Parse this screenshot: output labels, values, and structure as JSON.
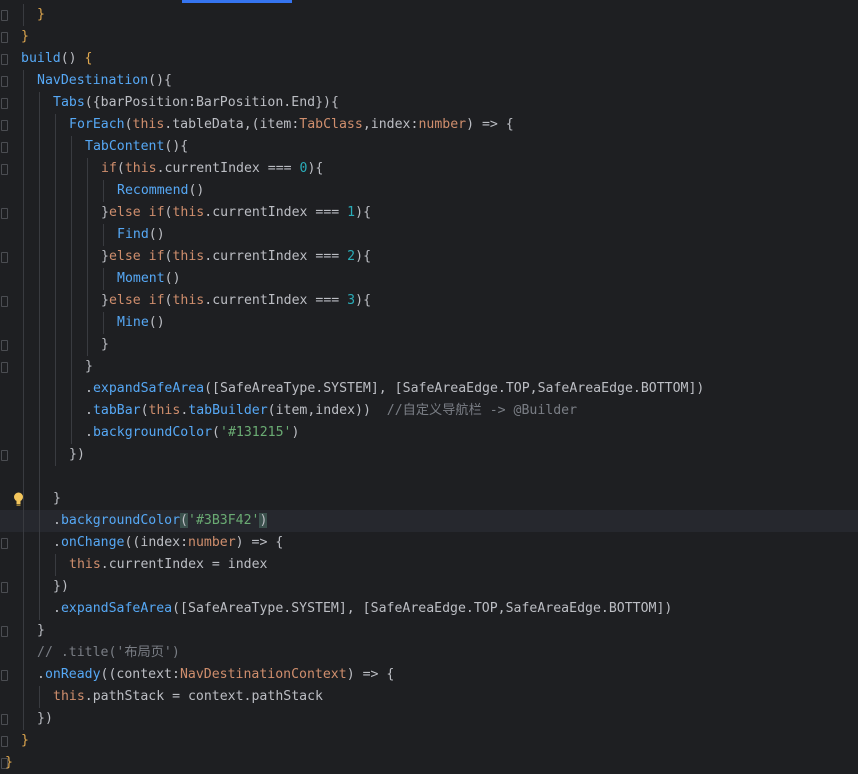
{
  "editor": {
    "accent_color": "#3574f0",
    "gutter_icons": {
      "intention_bulb": "lightbulb-icon",
      "fold_marker": "fold-marker-icon"
    },
    "lines": [
      {
        "indent": 1,
        "fold": true,
        "tokens": [
          {
            "t": "}",
            "c": "t-brace"
          }
        ]
      },
      {
        "indent": 0,
        "fold": true,
        "tokens": [
          {
            "t": "}",
            "c": "t-brace"
          }
        ]
      },
      {
        "indent": 0,
        "fold": true,
        "tokens": [
          {
            "t": "build",
            "c": "t-fn"
          },
          {
            "t": "() ",
            "c": "t-plain"
          },
          {
            "t": "{",
            "c": "t-brace"
          }
        ]
      },
      {
        "indent": 1,
        "fold": true,
        "tokens": [
          {
            "t": "NavDestination",
            "c": "t-comp"
          },
          {
            "t": "(){",
            "c": "t-plain"
          }
        ]
      },
      {
        "indent": 2,
        "fold": true,
        "tokens": [
          {
            "t": "Tabs",
            "c": "t-comp"
          },
          {
            "t": "({",
            "c": "t-plain"
          },
          {
            "t": "barPosition",
            "c": "t-plain"
          },
          {
            "t": ":",
            "c": "t-plain"
          },
          {
            "t": "BarPosition",
            "c": "t-plain"
          },
          {
            "t": ".",
            "c": "t-plain"
          },
          {
            "t": "End",
            "c": "t-plain"
          },
          {
            "t": "}){",
            "c": "t-plain"
          }
        ]
      },
      {
        "indent": 3,
        "fold": true,
        "tokens": [
          {
            "t": "ForEach",
            "c": "t-comp"
          },
          {
            "t": "(",
            "c": "t-plain"
          },
          {
            "t": "this",
            "c": "t-kw"
          },
          {
            "t": ".tableData,(",
            "c": "t-plain"
          },
          {
            "t": "item",
            "c": "t-plain"
          },
          {
            "t": ":",
            "c": "t-plain"
          },
          {
            "t": "TabClass",
            "c": "t-type"
          },
          {
            "t": ",",
            "c": "t-plain"
          },
          {
            "t": "index",
            "c": "t-plain"
          },
          {
            "t": ":",
            "c": "t-plain"
          },
          {
            "t": "number",
            "c": "t-type"
          },
          {
            "t": ") => {",
            "c": "t-plain"
          }
        ]
      },
      {
        "indent": 4,
        "fold": true,
        "tokens": [
          {
            "t": "TabContent",
            "c": "t-comp"
          },
          {
            "t": "(){",
            "c": "t-plain"
          }
        ]
      },
      {
        "indent": 5,
        "fold": true,
        "tokens": [
          {
            "t": "if",
            "c": "t-kw"
          },
          {
            "t": "(",
            "c": "t-plain"
          },
          {
            "t": "this",
            "c": "t-kw"
          },
          {
            "t": ".currentIndex === ",
            "c": "t-plain"
          },
          {
            "t": "0",
            "c": "t-num"
          },
          {
            "t": "){",
            "c": "t-plain"
          }
        ]
      },
      {
        "indent": 6,
        "fold": false,
        "tokens": [
          {
            "t": "Recommend",
            "c": "t-comp"
          },
          {
            "t": "()",
            "c": "t-plain"
          }
        ]
      },
      {
        "indent": 5,
        "fold": true,
        "tokens": [
          {
            "t": "}",
            "c": "t-plain"
          },
          {
            "t": "else if",
            "c": "t-kw"
          },
          {
            "t": "(",
            "c": "t-plain"
          },
          {
            "t": "this",
            "c": "t-kw"
          },
          {
            "t": ".currentIndex === ",
            "c": "t-plain"
          },
          {
            "t": "1",
            "c": "t-num"
          },
          {
            "t": "){",
            "c": "t-plain"
          }
        ]
      },
      {
        "indent": 6,
        "fold": false,
        "tokens": [
          {
            "t": "Find",
            "c": "t-comp"
          },
          {
            "t": "()",
            "c": "t-plain"
          }
        ]
      },
      {
        "indent": 5,
        "fold": true,
        "tokens": [
          {
            "t": "}",
            "c": "t-plain"
          },
          {
            "t": "else if",
            "c": "t-kw"
          },
          {
            "t": "(",
            "c": "t-plain"
          },
          {
            "t": "this",
            "c": "t-kw"
          },
          {
            "t": ".currentIndex === ",
            "c": "t-plain"
          },
          {
            "t": "2",
            "c": "t-num"
          },
          {
            "t": "){",
            "c": "t-plain"
          }
        ]
      },
      {
        "indent": 6,
        "fold": false,
        "tokens": [
          {
            "t": "Moment",
            "c": "t-comp"
          },
          {
            "t": "()",
            "c": "t-plain"
          }
        ]
      },
      {
        "indent": 5,
        "fold": true,
        "tokens": [
          {
            "t": "}",
            "c": "t-plain"
          },
          {
            "t": "else if",
            "c": "t-kw"
          },
          {
            "t": "(",
            "c": "t-plain"
          },
          {
            "t": "this",
            "c": "t-kw"
          },
          {
            "t": ".currentIndex === ",
            "c": "t-plain"
          },
          {
            "t": "3",
            "c": "t-num"
          },
          {
            "t": "){",
            "c": "t-plain"
          }
        ]
      },
      {
        "indent": 6,
        "fold": false,
        "tokens": [
          {
            "t": "Mine",
            "c": "t-comp"
          },
          {
            "t": "()",
            "c": "t-plain"
          }
        ]
      },
      {
        "indent": 5,
        "fold": true,
        "tokens": [
          {
            "t": "}",
            "c": "t-plain"
          }
        ]
      },
      {
        "indent": 4,
        "fold": true,
        "tokens": [
          {
            "t": "}",
            "c": "t-plain"
          }
        ]
      },
      {
        "indent": 4,
        "fold": false,
        "tokens": [
          {
            "t": ".",
            "c": "t-plain"
          },
          {
            "t": "expandSafeArea",
            "c": "t-fn"
          },
          {
            "t": "([",
            "c": "t-plain"
          },
          {
            "t": "SafeAreaType",
            "c": "t-plain"
          },
          {
            "t": ".SYSTEM], [",
            "c": "t-plain"
          },
          {
            "t": "SafeAreaEdge",
            "c": "t-plain"
          },
          {
            "t": ".TOP,",
            "c": "t-plain"
          },
          {
            "t": "SafeAreaEdge",
            "c": "t-plain"
          },
          {
            "t": ".BOTTOM])",
            "c": "t-plain"
          }
        ]
      },
      {
        "indent": 4,
        "fold": false,
        "tokens": [
          {
            "t": ".",
            "c": "t-plain"
          },
          {
            "t": "tabBar",
            "c": "t-fn"
          },
          {
            "t": "(",
            "c": "t-plain"
          },
          {
            "t": "this",
            "c": "t-kw"
          },
          {
            "t": ".",
            "c": "t-plain"
          },
          {
            "t": "tabBuilder",
            "c": "t-fn"
          },
          {
            "t": "(item,index))  ",
            "c": "t-plain"
          },
          {
            "t": "//自定义导航栏 -> @Builder",
            "c": "t-cmt"
          }
        ]
      },
      {
        "indent": 4,
        "fold": false,
        "tokens": [
          {
            "t": ".",
            "c": "t-plain"
          },
          {
            "t": "backgroundColor",
            "c": "t-fn"
          },
          {
            "t": "(",
            "c": "t-plain"
          },
          {
            "t": "'#131215'",
            "c": "t-str"
          },
          {
            "t": ")",
            "c": "t-plain"
          }
        ]
      },
      {
        "indent": 3,
        "fold": true,
        "tokens": [
          {
            "t": "})",
            "c": "t-plain"
          }
        ]
      },
      {
        "indent": 0,
        "fold": false,
        "tokens": []
      },
      {
        "indent": 2,
        "fold": false,
        "bulb": true,
        "tokens": [
          {
            "t": "}",
            "c": "t-plain"
          }
        ]
      },
      {
        "indent": 2,
        "fold": false,
        "current": true,
        "tokens": [
          {
            "t": ".",
            "c": "t-plain"
          },
          {
            "t": "backgroundColor",
            "c": "t-fn"
          },
          {
            "t": "(",
            "c": "t-hl"
          },
          {
            "t": "'#3B3F42'",
            "c": "t-str"
          },
          {
            "t": ")",
            "c": "t-hl"
          }
        ]
      },
      {
        "indent": 2,
        "fold": true,
        "tokens": [
          {
            "t": ".",
            "c": "t-plain"
          },
          {
            "t": "onChange",
            "c": "t-fn"
          },
          {
            "t": "((",
            "c": "t-plain"
          },
          {
            "t": "index",
            "c": "t-plain"
          },
          {
            "t": ":",
            "c": "t-plain"
          },
          {
            "t": "number",
            "c": "t-type"
          },
          {
            "t": ") => {",
            "c": "t-plain"
          }
        ]
      },
      {
        "indent": 3,
        "fold": false,
        "tokens": [
          {
            "t": "this",
            "c": "t-kw"
          },
          {
            "t": ".currentIndex = index",
            "c": "t-plain"
          }
        ]
      },
      {
        "indent": 2,
        "fold": true,
        "tokens": [
          {
            "t": "})",
            "c": "t-plain"
          }
        ]
      },
      {
        "indent": 2,
        "fold": false,
        "tokens": [
          {
            "t": ".",
            "c": "t-plain"
          },
          {
            "t": "expandSafeArea",
            "c": "t-fn"
          },
          {
            "t": "([",
            "c": "t-plain"
          },
          {
            "t": "SafeAreaType",
            "c": "t-plain"
          },
          {
            "t": ".SYSTEM], [",
            "c": "t-plain"
          },
          {
            "t": "SafeAreaEdge",
            "c": "t-plain"
          },
          {
            "t": ".TOP,",
            "c": "t-plain"
          },
          {
            "t": "SafeAreaEdge",
            "c": "t-plain"
          },
          {
            "t": ".BOTTOM])",
            "c": "t-plain"
          }
        ]
      },
      {
        "indent": 1,
        "fold": true,
        "tokens": [
          {
            "t": "}",
            "c": "t-plain"
          }
        ]
      },
      {
        "indent": 1,
        "fold": false,
        "tokens": [
          {
            "t": "// .title('布局页')",
            "c": "t-cmt"
          }
        ]
      },
      {
        "indent": 1,
        "fold": true,
        "tokens": [
          {
            "t": ".",
            "c": "t-plain"
          },
          {
            "t": "onReady",
            "c": "t-fn"
          },
          {
            "t": "((",
            "c": "t-plain"
          },
          {
            "t": "context",
            "c": "t-plain"
          },
          {
            "t": ":",
            "c": "t-plain"
          },
          {
            "t": "NavDestinationContext",
            "c": "t-type"
          },
          {
            "t": ") => {",
            "c": "t-plain"
          }
        ]
      },
      {
        "indent": 2,
        "fold": false,
        "tokens": [
          {
            "t": "this",
            "c": "t-kw"
          },
          {
            "t": ".pathStack = context.pathStack",
            "c": "t-plain"
          }
        ]
      },
      {
        "indent": 1,
        "fold": true,
        "tokens": [
          {
            "t": "})",
            "c": "t-plain"
          }
        ]
      },
      {
        "indent": 0,
        "fold": true,
        "tokens": [
          {
            "t": "}",
            "c": "t-brace"
          }
        ]
      },
      {
        "indent": -1,
        "fold": true,
        "tokens": [
          {
            "t": "}",
            "c": "t-brace"
          }
        ]
      }
    ]
  }
}
